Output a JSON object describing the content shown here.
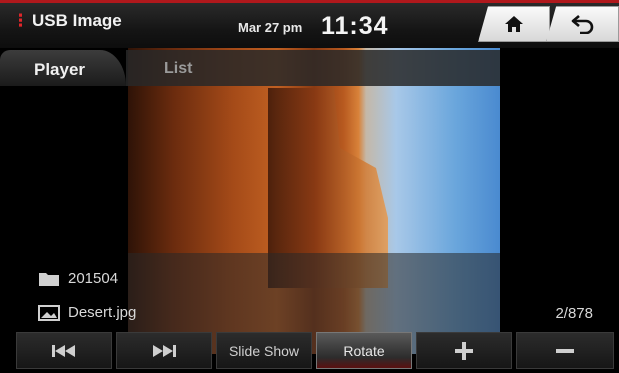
{
  "header": {
    "app_title": "USB Image",
    "date": "Mar 27 pm",
    "time": "11:34",
    "home_icon": "home-icon",
    "back_icon": "back-arrow-icon"
  },
  "tabs": [
    {
      "label": "Player",
      "selected": true
    },
    {
      "label": "List",
      "selected": false
    }
  ],
  "info": {
    "folder_name": "201504",
    "file_name": "Desert.jpg",
    "counter": "2/878"
  },
  "controls": {
    "prev_icon": "skip-previous-icon",
    "next_icon": "skip-next-icon",
    "slideshow_label": "Slide Show",
    "rotate_label": "Rotate",
    "zoom_in_icon": "plus-icon",
    "zoom_out_icon": "minus-icon"
  },
  "colors": {
    "accent_red": "#b0181c",
    "background": "#000000"
  }
}
